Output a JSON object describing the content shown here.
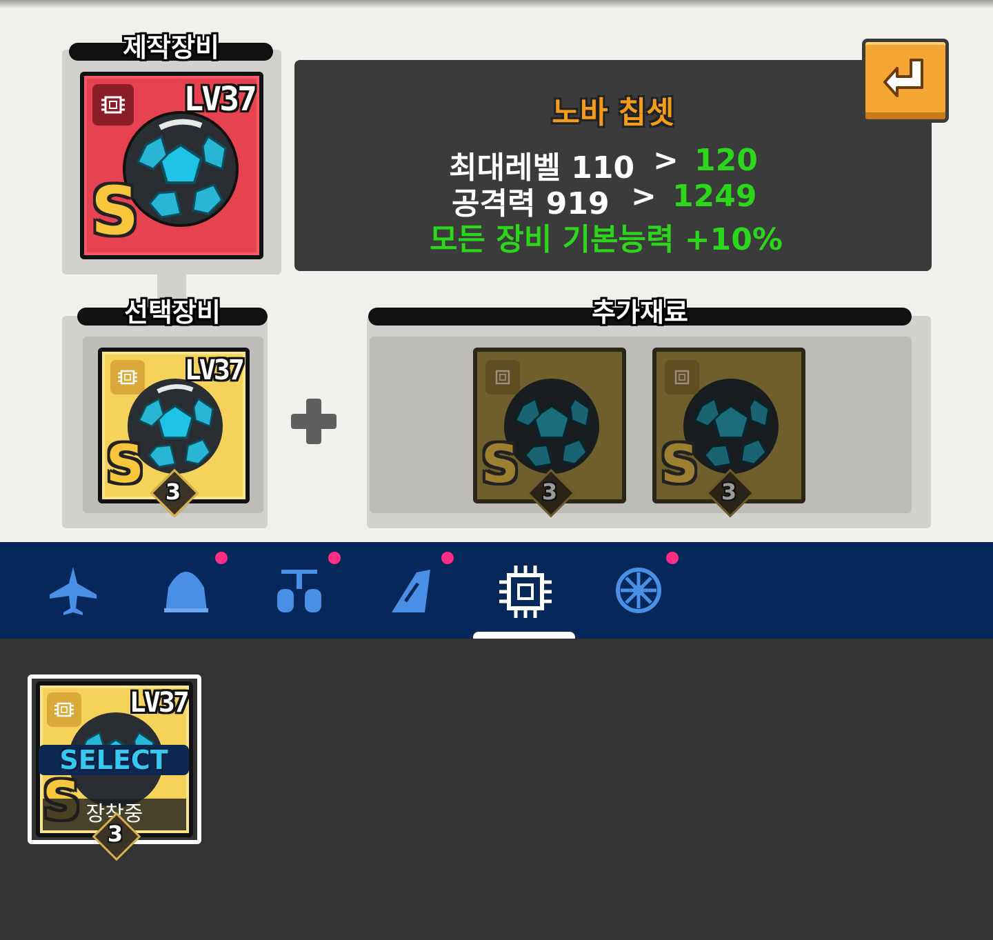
{
  "panels": {
    "crafted_label": "제작장비",
    "selected_label": "선택장비",
    "extra_label": "추가재료"
  },
  "item": {
    "name": "노바 칩셋",
    "level": "LV37",
    "grade": "S",
    "stack": "3"
  },
  "stats": {
    "max_level_label": "최대레벨 110",
    "max_level_arrow": ">",
    "max_level_new": "120",
    "attack_label": "공격력 919",
    "attack_arrow": ">",
    "attack_new": "1249",
    "bonus": "모든 장비 기본능력 +10%"
  },
  "nav": {
    "tabs": [
      {
        "icon": "airplane-icon",
        "dot": false
      },
      {
        "icon": "dome-icon",
        "dot": true
      },
      {
        "icon": "turret-icon",
        "dot": true
      },
      {
        "icon": "wing-icon",
        "dot": true
      },
      {
        "icon": "chip-icon",
        "dot": false,
        "active": true
      },
      {
        "icon": "core-icon",
        "dot": true
      }
    ]
  },
  "inventory": {
    "select_label": "SELECT",
    "equipped_label": "장착중"
  },
  "colors": {
    "accent_orange": "#f59b1c",
    "stat_green": "#2bd61b",
    "nav_bg": "#06275a",
    "notify_dot": "#ff2e84"
  }
}
